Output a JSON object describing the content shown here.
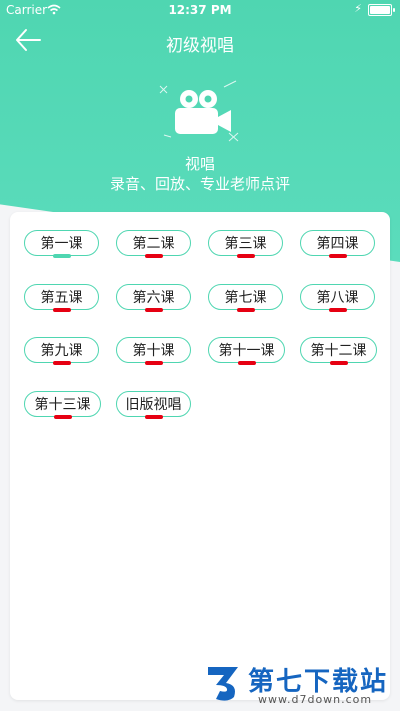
{
  "status": {
    "carrier": "Carrier",
    "time": "12:37 PM"
  },
  "nav": {
    "title": "初级视唱",
    "back_icon": "arrow-left-icon"
  },
  "hero": {
    "icon": "video-camera-icon",
    "title": "视唱",
    "subtitle": "录音、回放、专业老师点评"
  },
  "colors": {
    "accent": "#4fd6b1",
    "marker": "#e60012",
    "background": "#f4f5f7"
  },
  "lessons": [
    {
      "label": "第一课",
      "active": true
    },
    {
      "label": "第二课",
      "active": false
    },
    {
      "label": "第三课",
      "active": false
    },
    {
      "label": "第四课",
      "active": false
    },
    {
      "label": "第五课",
      "active": false
    },
    {
      "label": "第六课",
      "active": false
    },
    {
      "label": "第七课",
      "active": false
    },
    {
      "label": "第八课",
      "active": false
    },
    {
      "label": "第九课",
      "active": false
    },
    {
      "label": "第十课",
      "active": false
    },
    {
      "label": "第十一课",
      "active": false
    },
    {
      "label": "第十二课",
      "active": false
    },
    {
      "label": "第十三课",
      "active": false
    },
    {
      "label": "旧版视唱",
      "active": false
    }
  ],
  "watermark": {
    "name": "第七下载站",
    "url": "www.d7down.com"
  }
}
